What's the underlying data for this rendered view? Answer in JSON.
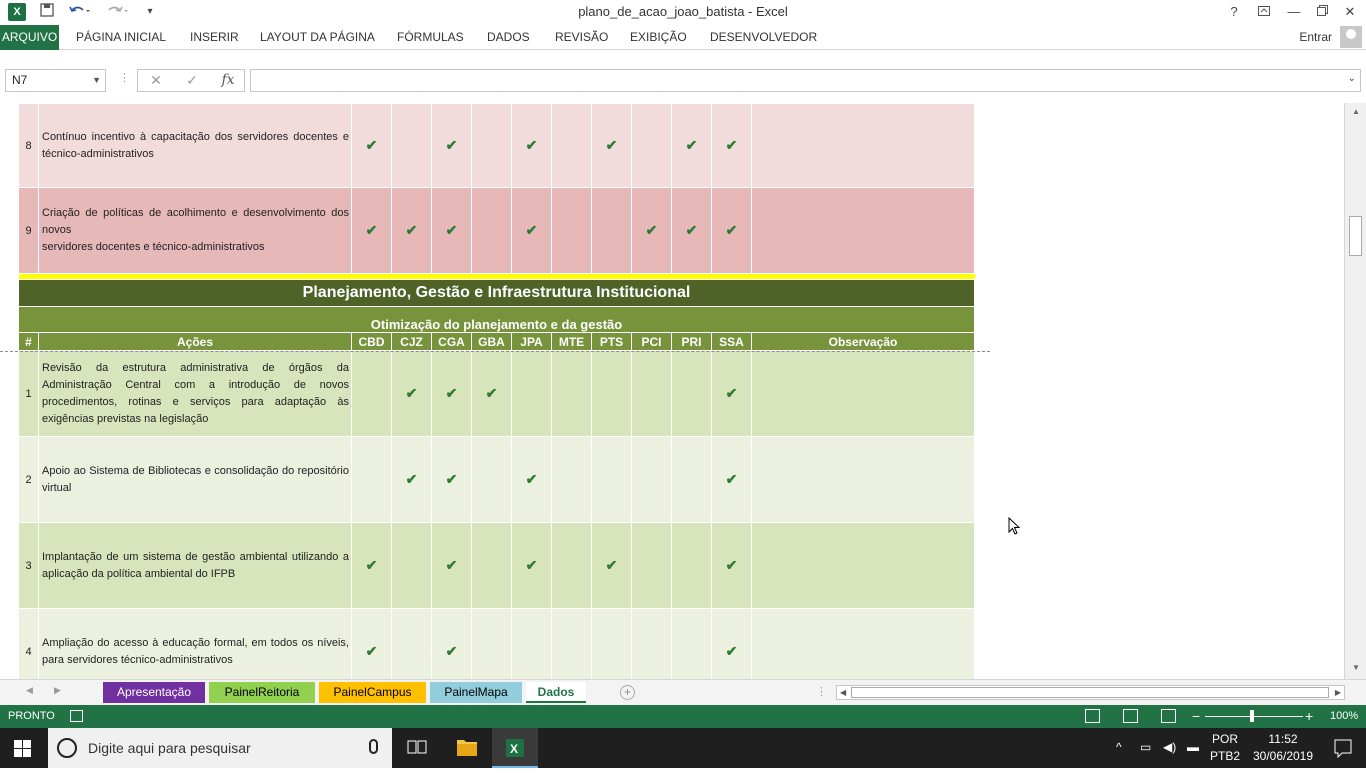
{
  "app": {
    "title": "plano_de_acao_joao_batista - Excel",
    "logo": "X",
    "help": "?",
    "signin": "Entrar"
  },
  "ribbon": {
    "file_tab": "ARQUIVO",
    "tabs": [
      "PÁGINA INICIAL",
      "INSERIR",
      "LAYOUT DA PÁGINA",
      "FÓRMULAS",
      "DADOS",
      "REVISÃO",
      "EXIBIÇÃO",
      "DESENVOLVEDOR"
    ]
  },
  "formula_bar": {
    "name_box": "N7",
    "fx": "fx",
    "value": ""
  },
  "sheet": {
    "top_rows": [
      {
        "num": "8",
        "action": "Contínuo incentivo à capacitação dos servidores docentes e técnico-administrativos",
        "checks": [
          1,
          0,
          1,
          0,
          1,
          0,
          1,
          0,
          1,
          1
        ]
      },
      {
        "num": "9",
        "action": "Criação de políticas de acolhimento e desenvolvimento dos novos\nservidores docentes e técnico-administrativos",
        "checks": [
          1,
          1,
          1,
          0,
          1,
          0,
          0,
          1,
          1,
          1
        ]
      }
    ],
    "section_title": "Planejamento, Gestão e Infraestrutura Institucional",
    "subsection_title": "Otimização do planejamento e da gestão",
    "headers": {
      "num": "#",
      "action": "Ações",
      "campuses": [
        "CBD",
        "CJZ",
        "CGA",
        "GBA",
        "JPA",
        "MTE",
        "PTS",
        "PCI",
        "PRI",
        "SSA"
      ],
      "notes": "Observação"
    },
    "check_mark": "✔",
    "rows": [
      {
        "num": "1",
        "action": "Revisão da estrutura administrativa de órgãos da Administração Central com a introdução de novos procedimentos, rotinas e serviços para adaptação às exigências previstas na legislação",
        "checks": [
          0,
          1,
          1,
          1,
          0,
          0,
          0,
          0,
          0,
          1
        ]
      },
      {
        "num": "2",
        "action": "Apoio ao Sistema de Bibliotecas e consolidação do repositório virtual",
        "checks": [
          0,
          1,
          1,
          0,
          1,
          0,
          0,
          0,
          0,
          1
        ]
      },
      {
        "num": "3",
        "action": "Implantação de um sistema de gestão ambiental utilizando a aplicação da política ambiental do IFPB",
        "checks": [
          1,
          0,
          1,
          0,
          1,
          0,
          1,
          0,
          0,
          1
        ]
      },
      {
        "num": "4",
        "action": "Ampliação do acesso à educação formal, em todos os níveis, para servidores técnico-administrativos",
        "checks": [
          1,
          0,
          1,
          0,
          0,
          0,
          0,
          0,
          0,
          1
        ]
      }
    ]
  },
  "sheet_tabs": {
    "tabs": [
      {
        "label": "Apresentação",
        "bg": "#7030a0",
        "fg": "#ffffff"
      },
      {
        "label": "PainelReitoria",
        "bg": "#92d050",
        "fg": "#000000"
      },
      {
        "label": "PainelCampus",
        "bg": "#ffc000",
        "fg": "#000000"
      },
      {
        "label": "PainelMapa",
        "bg": "#92cddc",
        "fg": "#000000"
      },
      {
        "label": "Dados",
        "bg": "#ffffff",
        "fg": "#217346"
      }
    ],
    "add": "+"
  },
  "status": {
    "ready": "PRONTO",
    "zoom": "100%"
  },
  "taskbar": {
    "search_placeholder": "Digite aqui para pesquisar",
    "lang_top": "POR",
    "lang_bottom": "PTB2",
    "time": "11:52",
    "date": "30/06/2019"
  },
  "colors": {
    "excel_green": "#217346",
    "section_dark": "#4f6228",
    "section_mid": "#77933c",
    "check": "#2e7d32"
  }
}
